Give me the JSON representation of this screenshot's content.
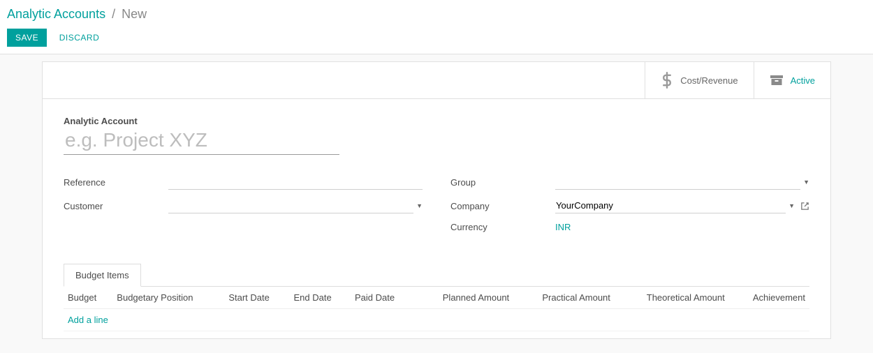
{
  "breadcrumb": {
    "parent": "Analytic Accounts",
    "current": "New"
  },
  "actions": {
    "save": "SAVE",
    "discard": "DISCARD"
  },
  "stat_buttons": {
    "cost_revenue": "Cost/Revenue",
    "active": "Active"
  },
  "form": {
    "name_label": "Analytic Account",
    "name_value": "",
    "name_placeholder": "e.g. Project XYZ",
    "reference": {
      "label": "Reference",
      "value": ""
    },
    "customer": {
      "label": "Customer",
      "value": ""
    },
    "group": {
      "label": "Group",
      "value": ""
    },
    "company": {
      "label": "Company",
      "value": "YourCompany"
    },
    "currency": {
      "label": "Currency",
      "value": "INR"
    }
  },
  "tabs": {
    "budget_items": "Budget Items"
  },
  "budget_columns": {
    "budget": "Budget",
    "budgetary_position": "Budgetary Position",
    "start_date": "Start Date",
    "end_date": "End Date",
    "paid_date": "Paid Date",
    "planned_amount": "Planned Amount",
    "practical_amount": "Practical Amount",
    "theoretical_amount": "Theoretical Amount",
    "achievement": "Achievement"
  },
  "add_line": "Add a line"
}
